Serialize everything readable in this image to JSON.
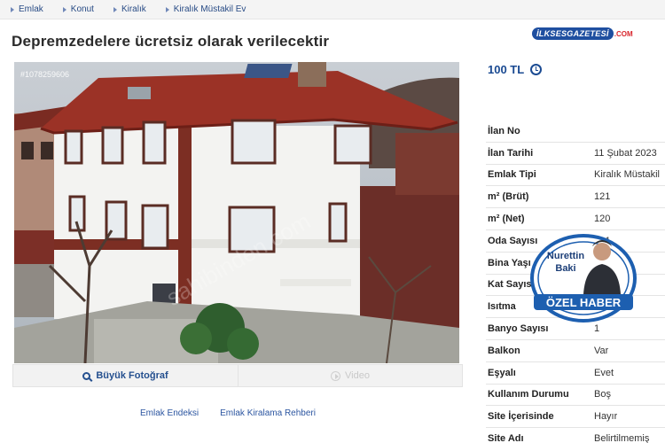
{
  "breadcrumb": [
    "Emlak",
    "Konut",
    "Kiralık",
    "Kiralık Müstakil Ev"
  ],
  "title": "Depremzedelere ücretsiz olarak verilecektir",
  "watermark_logo": {
    "name": "İLKSESGAZETESİ",
    "tld": ".COM"
  },
  "photo": {
    "listing_id": "#1078259606",
    "big_photo_label": "Büyük Fotoğraf",
    "video_label": "Video"
  },
  "price": "100 TL",
  "details": [
    {
      "key": "İlan No",
      "value": ""
    },
    {
      "key": "İlan Tarihi",
      "value": "11 Şubat 2023"
    },
    {
      "key": "Emlak Tipi",
      "value": "Kiralık Müstakil"
    },
    {
      "key": "m² (Brüt)",
      "value": "121"
    },
    {
      "key": "m² (Net)",
      "value": "120"
    },
    {
      "key": "Oda Sayısı",
      "value": "3+1"
    },
    {
      "key": "Bina Yaşı",
      "value": ""
    },
    {
      "key": "Kat Sayısı",
      "value": ""
    },
    {
      "key": "Isıtma",
      "value": ""
    },
    {
      "key": "Banyo Sayısı",
      "value": "1"
    },
    {
      "key": "Balkon",
      "value": "Var"
    },
    {
      "key": "Eşyalı",
      "value": "Evet"
    },
    {
      "key": "Kullanım Durumu",
      "value": "Boş"
    },
    {
      "key": "Site İçerisinde",
      "value": "Hayır"
    },
    {
      "key": "Site Adı",
      "value": "Belirtilmemiş"
    }
  ],
  "footer_links": [
    "Emlak Endeksi",
    "Emlak Kiralama Rehberi"
  ],
  "badge": {
    "first_name": "Nurettin",
    "last_name": "Baki",
    "label": "ÖZEL HABER"
  },
  "colors": {
    "link": "#284b85",
    "price": "#1a4a92",
    "badge_blue": "#1d5fb0"
  }
}
